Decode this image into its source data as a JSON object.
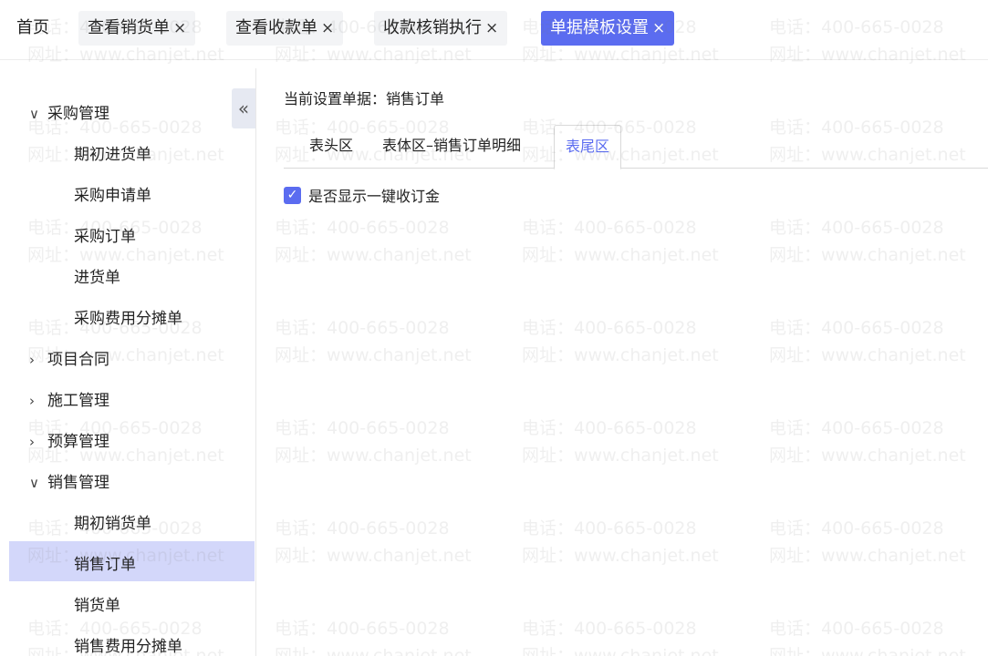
{
  "tabs": [
    {
      "label": "首页",
      "close": ""
    },
    {
      "label": "查看销货单",
      "close": "×"
    },
    {
      "label": "查看收款单",
      "close": "×"
    },
    {
      "label": "收款核销执行",
      "close": "×"
    },
    {
      "label": "单据模板设置",
      "close": "×"
    }
  ],
  "sidebar": {
    "collapse_icon": "«",
    "groups": [
      {
        "label": "采购管理",
        "chevron": "∨"
      },
      {
        "label": "项目合同",
        "chevron": "›"
      },
      {
        "label": "施工管理",
        "chevron": "›"
      },
      {
        "label": "预算管理",
        "chevron": "›"
      },
      {
        "label": "销售管理",
        "chevron": "∨"
      }
    ],
    "purchase_items": [
      "期初进货单",
      "采购申请单",
      "采购订单",
      "进货单",
      "采购费用分摊单"
    ],
    "sales_items": [
      "期初销货单",
      "销售订单",
      "销货单",
      "销售费用分摊单"
    ],
    "selected_item": "销售订单"
  },
  "main": {
    "current_doc": "当前设置单据：销售订单",
    "subtabs": [
      "表头区",
      "表体区–销售订单明细",
      "表尾区"
    ],
    "active_subtab": "表尾区",
    "checkbox_label": "是否显示一键收订金",
    "checkbox_checked": true,
    "checkbox_mark": "✓"
  },
  "watermark": {
    "phone": "电话：400-665-0028",
    "site": "网址：www.chanjet.net"
  },
  "colors": {
    "accent": "#5b6cf0",
    "selected_bg": "#d3d7fa"
  }
}
